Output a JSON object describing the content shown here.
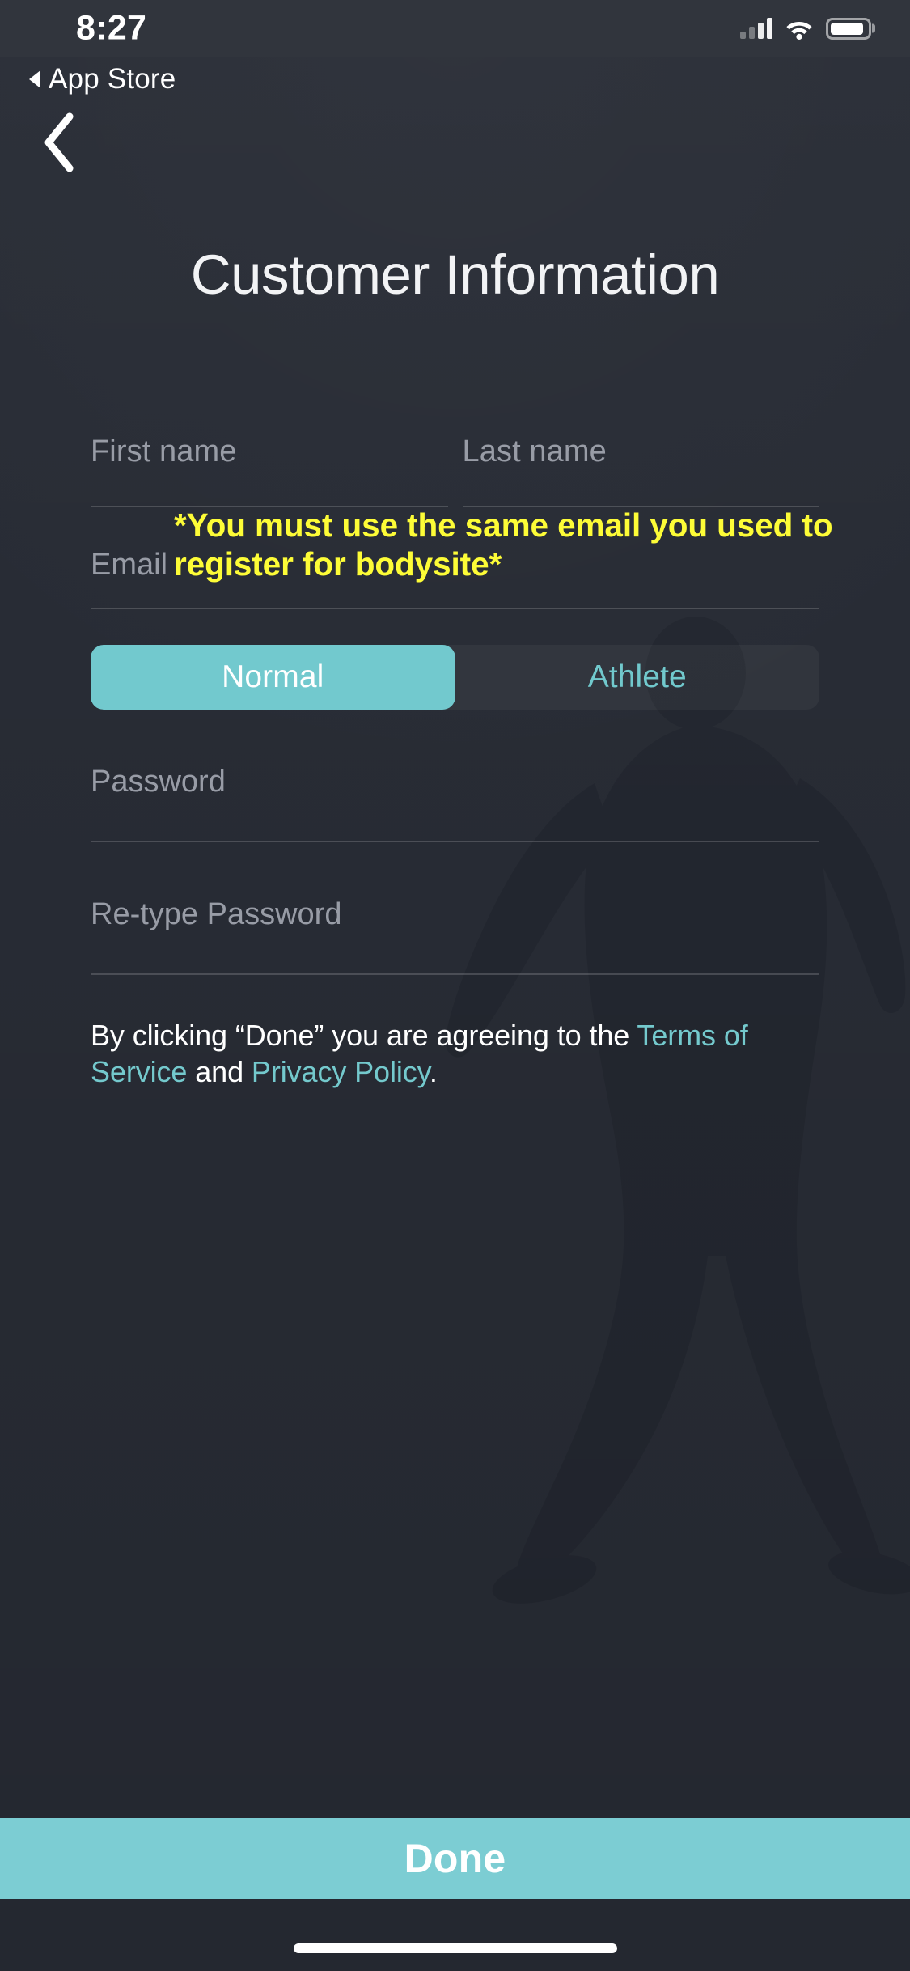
{
  "status_bar": {
    "time": "8:27",
    "cellular_icon": "cellular-signal-icon",
    "wifi_icon": "wifi-icon",
    "battery_icon": "battery-icon"
  },
  "return_chip": {
    "label": "App Store",
    "icon": "back-triangle-icon"
  },
  "nav": {
    "back_icon": "chevron-left-icon"
  },
  "header": {
    "title": "Customer Information"
  },
  "form": {
    "first_name": {
      "placeholder": "First name",
      "value": ""
    },
    "last_name": {
      "placeholder": "Last name",
      "value": ""
    },
    "email": {
      "placeholder": "Email",
      "value": ""
    },
    "warning": "*You must use the same email you used to register for bodysite*",
    "account_type": {
      "options": [
        "Normal",
        "Athlete"
      ],
      "selected": "Normal"
    },
    "password": {
      "placeholder": "Password",
      "value": ""
    },
    "retype_password": {
      "placeholder": "Re-type Password",
      "value": ""
    }
  },
  "terms": {
    "prefix": "By clicking “Done” you are agreeing to the ",
    "terms_link": "Terms of Service",
    "conjunction": " and ",
    "privacy_link": "Privacy Policy",
    "suffix": "."
  },
  "footer": {
    "done_label": "Done"
  },
  "colors": {
    "background": "#282c35",
    "accent": "#7ccdd3",
    "warning": "#fdfc37",
    "link": "#74c9cd",
    "placeholder": "#989ca6"
  }
}
